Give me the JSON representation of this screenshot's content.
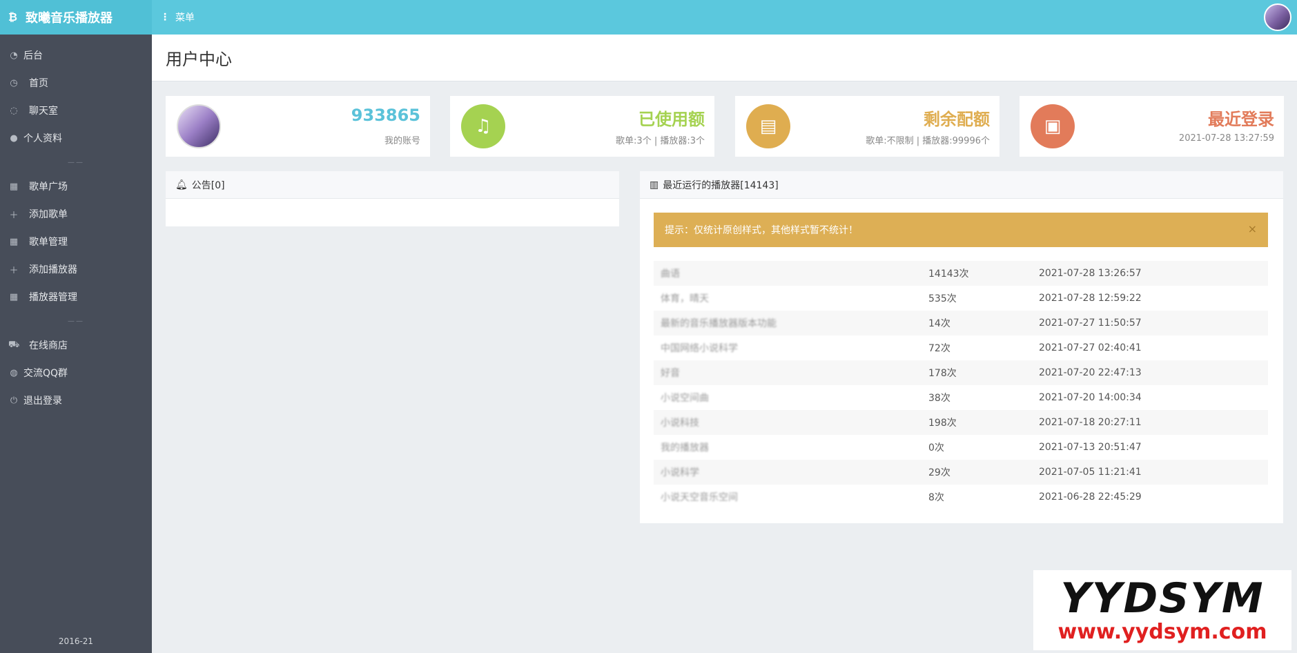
{
  "header": {
    "brand": "致曦音乐播放器",
    "menu_label": "菜单"
  },
  "sidebar": {
    "items": [
      {
        "label": "后台",
        "icon": "pie-chart-icon"
      },
      {
        "label": "首页",
        "icon": "dashboard-icon"
      },
      {
        "label": "聊天室",
        "icon": "chat-icon"
      },
      {
        "label": "个人资料",
        "icon": "user-icon"
      },
      {
        "label": "歌单广场",
        "icon": "table-icon"
      },
      {
        "label": "添加歌单",
        "icon": "plus-icon"
      },
      {
        "label": "歌单管理",
        "icon": "table-icon"
      },
      {
        "label": "添加播放器",
        "icon": "plus-icon"
      },
      {
        "label": "播放器管理",
        "icon": "table-icon"
      },
      {
        "label": "在线商店",
        "icon": "cart-icon"
      },
      {
        "label": "交流QQ群",
        "icon": "globe-icon"
      },
      {
        "label": "退出登录",
        "icon": "power-icon"
      }
    ],
    "separator": "——",
    "footer": "2016-21"
  },
  "page": {
    "title": "用户中心"
  },
  "stats": {
    "account": {
      "value": "933865",
      "label": "我的账号",
      "color": "#5bc2d9"
    },
    "used": {
      "title": "已使用额",
      "detail": "歌单:3个 | 播放器:3个",
      "color": "#a5d251"
    },
    "remaining": {
      "title": "剩余配额",
      "detail": "歌单:不限制 | 播放器:99996个",
      "color": "#dfad50"
    },
    "last_login": {
      "title": "最近登录",
      "detail": "2021-07-28 13:27:59",
      "color": "#e27b5a"
    }
  },
  "notice": {
    "title": "公告[0]"
  },
  "players": {
    "title": "最近运行的播放器[14143]",
    "alert": "提示：仅统计原创样式，其他样式暂不统计！",
    "rows": [
      {
        "name": "曲语",
        "count": "14143次",
        "time": "2021-07-28 13:26:57"
      },
      {
        "name": "体育，晴天",
        "count": "535次",
        "time": "2021-07-28 12:59:22"
      },
      {
        "name": "最新的音乐播放器版本功能",
        "count": "14次",
        "time": "2021-07-27 11:50:57"
      },
      {
        "name": "中国网络小说科学",
        "count": "72次",
        "time": "2021-07-27 02:40:41"
      },
      {
        "name": "好音",
        "count": "178次",
        "time": "2021-07-20 22:47:13"
      },
      {
        "name": "小说空间曲",
        "count": "38次",
        "time": "2021-07-20 14:00:34"
      },
      {
        "name": "小说科技",
        "count": "198次",
        "time": "2021-07-18 20:27:11"
      },
      {
        "name": "我的播放器",
        "count": "0次",
        "time": "2021-07-13 20:51:47"
      },
      {
        "name": "小说科学",
        "count": "29次",
        "time": "2021-07-05 11:21:41"
      },
      {
        "name": "小说天空音乐空间",
        "count": "8次",
        "time": "2021-06-28 22:45:29"
      }
    ]
  },
  "watermark": {
    "line1": "YYDSYM",
    "line2": "www.yydsym.com"
  }
}
